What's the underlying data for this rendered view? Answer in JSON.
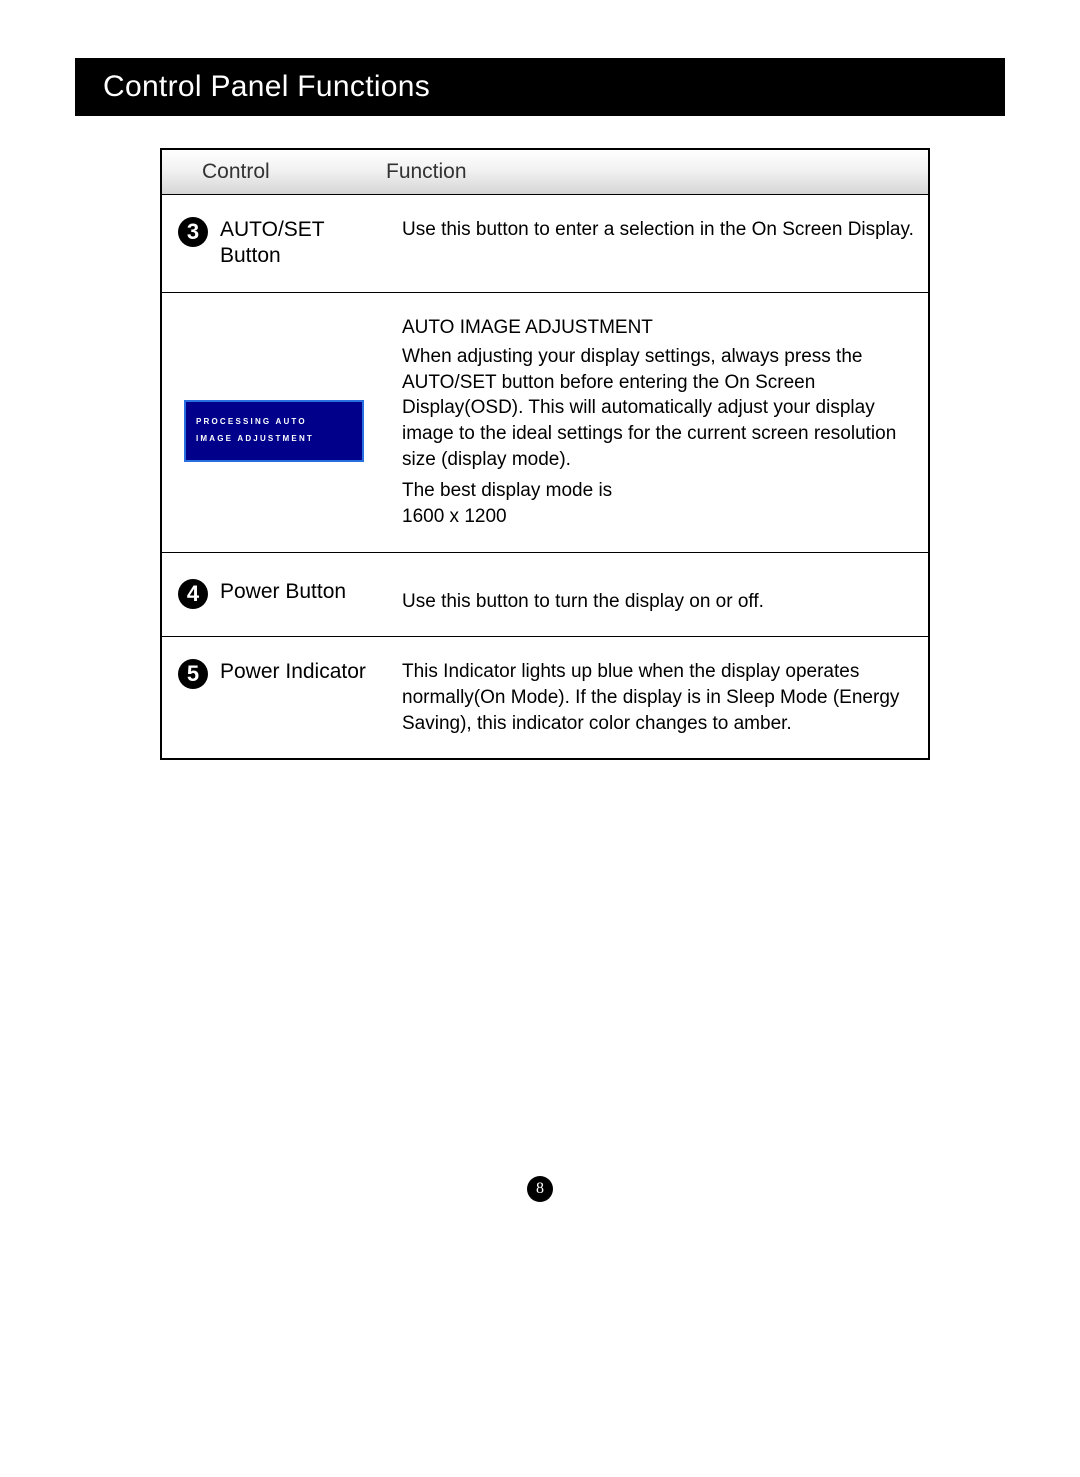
{
  "header": {
    "title": "Control Panel Functions"
  },
  "table": {
    "headers": {
      "control": "Control",
      "function": "Function"
    },
    "rows": [
      {
        "num": "3",
        "control_line1": "AUTO/SET",
        "control_line2": "Button",
        "function": "Use this button to enter a selection in the On Screen Display."
      },
      {
        "num": "",
        "osd_line1": "PROCESSING AUTO",
        "osd_line2": "IMAGE ADJUSTMENT",
        "func_heading": "AUTO IMAGE ADJUSTMENT",
        "func_body": "When adjusting your display settings, always press the AUTO/SET button before entering the On Screen Display(OSD). This will automatically adjust your display image to the ideal settings for the current screen resolution size (display mode).",
        "func_line2": "The best display mode is",
        "func_line3": "1600 x 1200"
      },
      {
        "num": "4",
        "control_line1": "Power Button",
        "function": "Use this button to turn the display on or off."
      },
      {
        "num": "5",
        "control_line1": "Power Indicator",
        "function": "This Indicator lights up blue when the display operates normally(On Mode). If the display is in Sleep Mode (Energy Saving), this indicator color changes to amber."
      }
    ]
  },
  "page_number": "8"
}
